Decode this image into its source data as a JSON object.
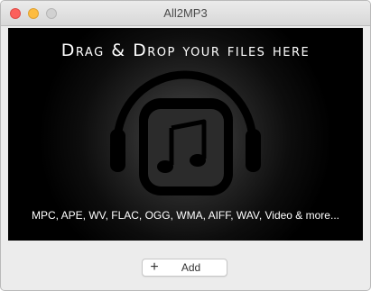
{
  "window": {
    "title": "All2MP3"
  },
  "drop_area": {
    "heading": "Drag & Drop your files here",
    "formats": "MPC, APE, WV, FLAC, OGG, WMA, AIFF, WAV, Video & more...",
    "logo_icon": "headphones-music-note-icon"
  },
  "toolbar": {
    "add_icon": "plus-icon",
    "add_label": "Add"
  },
  "colors": {
    "close": "#fc605c",
    "minimize": "#fdbc40",
    "zoom_disabled": "#d1d1d1",
    "drop_background": "#000000",
    "drop_text": "#ffffff"
  }
}
